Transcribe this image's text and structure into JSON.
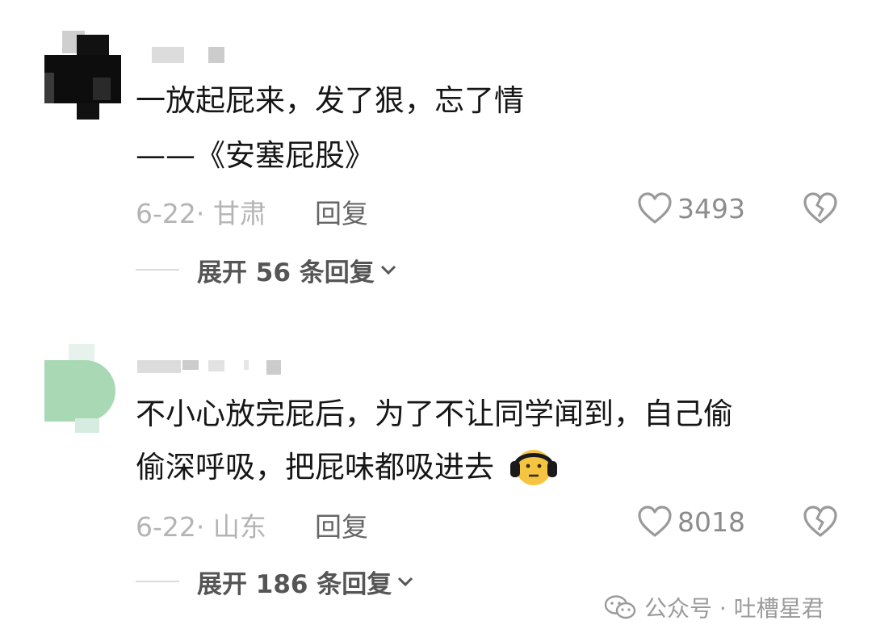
{
  "comments": [
    {
      "body_lines": [
        "一放起屁来，发了狠，忘了情",
        "——《安塞屁股》"
      ],
      "meta": "6-22· 甘肃",
      "reply_label": "回复",
      "likes": "3493",
      "expand_label": "展开 56 条回复"
    },
    {
      "body_lines": [
        "不小心放完屁后，为了不让同学闻到，自己偷",
        "偷深呼吸，把屁味都吸进去"
      ],
      "meta": "6-22· 山东",
      "reply_label": "回复",
      "likes": "8018",
      "expand_label": "展开 186 条回复",
      "emoji": "headphones-face-emoji"
    }
  ],
  "watermark": "公众号 · 吐槽星君",
  "icons": [
    "heart-icon",
    "broken-heart-icon",
    "chevron-down-icon",
    "wechat-icon"
  ],
  "colors": {
    "text": "#161616",
    "meta": "#b4b4b4",
    "reply": "#666666",
    "avatar2": "#a8d8b4"
  }
}
